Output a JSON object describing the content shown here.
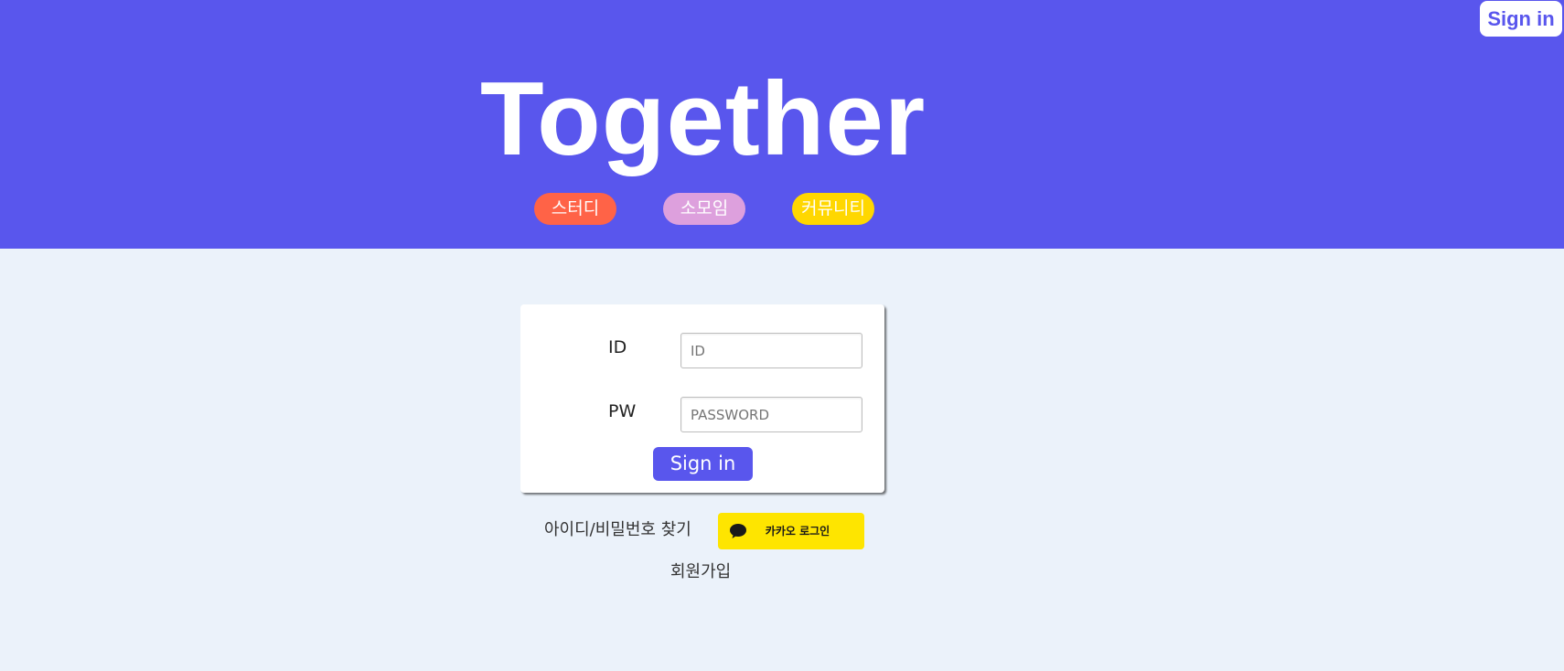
{
  "header": {
    "logo": "Together",
    "signin_label": "Sign in",
    "nav": [
      {
        "label": "스터디",
        "color": "#ff6347"
      },
      {
        "label": "소모임",
        "color": "#dda0dd"
      },
      {
        "label": "커뮤니티",
        "color": "#ffd700"
      }
    ],
    "background": "#5956ed"
  },
  "login": {
    "id_label": "ID",
    "id_placeholder": "ID",
    "pw_label": "PW",
    "pw_placeholder": "PASSWORD",
    "submit_label": "Sign in"
  },
  "links": {
    "find_account": "아이디/비밀번호 찾기",
    "kakao_login": "카카오 로그인",
    "kakao_icon": "speech-bubble-icon",
    "signup": "회원가입"
  },
  "colors": {
    "accent": "#5956ed",
    "page_background": "#ebf2fa",
    "kakao": "#fee500"
  }
}
